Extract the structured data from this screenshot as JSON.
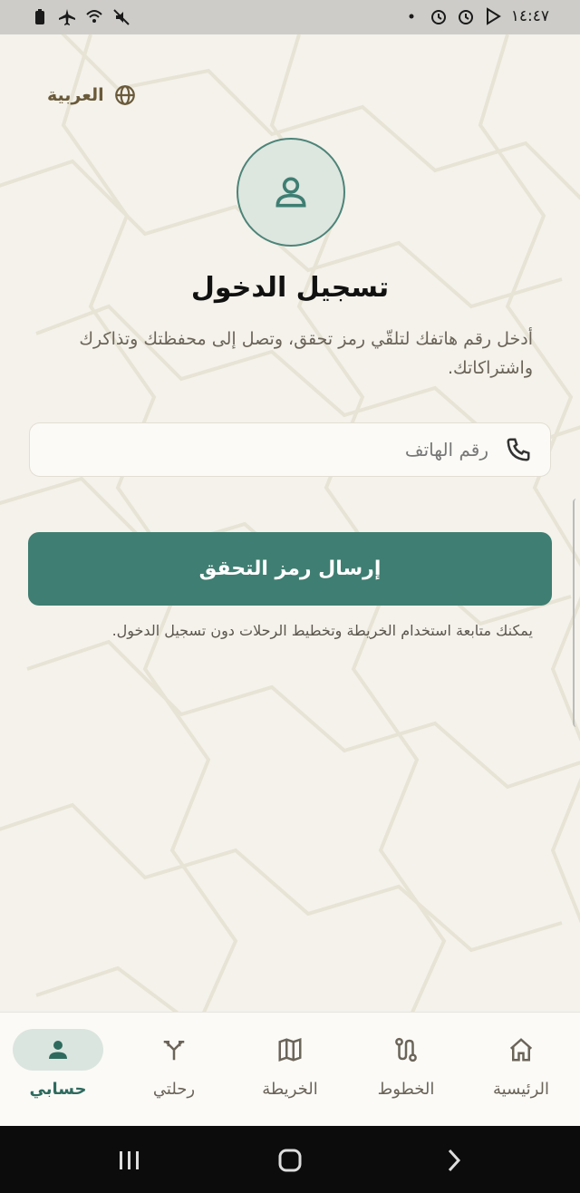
{
  "status_bar": {
    "time": "١٤:٤٧",
    "icons": [
      "battery-icon",
      "airplane-mode-icon",
      "wifi-icon",
      "mute-icon",
      "dot-icon",
      "alarm-icon",
      "alarm-icon",
      "play-store-icon"
    ]
  },
  "header": {
    "language_label": "العربية",
    "language_icon": "globe-icon"
  },
  "login": {
    "avatar_icon": "user-icon",
    "title": "تسجيل الدخول",
    "description": "أدخل رقم هاتفك لتلقّي رمز تحقق، وتصل إلى محفظتك وتذاكرك واشتراكاتك.",
    "phone_placeholder": "رقم الهاتف",
    "phone_icon": "phone-icon",
    "submit_label": "إرسال رمز التحقق",
    "guest_note": "يمكنك متابعة استخدام الخريطة وتخطيط الرحلات دون تسجيل الدخول."
  },
  "tabs": [
    {
      "label": "الرئيسية",
      "icon": "home-icon",
      "active": false
    },
    {
      "label": "الخطوط",
      "icon": "route-icon",
      "active": false
    },
    {
      "label": "الخريطة",
      "icon": "map-icon",
      "active": false
    },
    {
      "label": "رحلتي",
      "icon": "trip-fork-icon",
      "active": false
    },
    {
      "label": "حسابي",
      "icon": "user-icon",
      "active": true
    }
  ],
  "colors": {
    "accent": "#3f7e72",
    "background": "#f4f2eb",
    "title": "#111111",
    "language": "#6a5a3a"
  }
}
